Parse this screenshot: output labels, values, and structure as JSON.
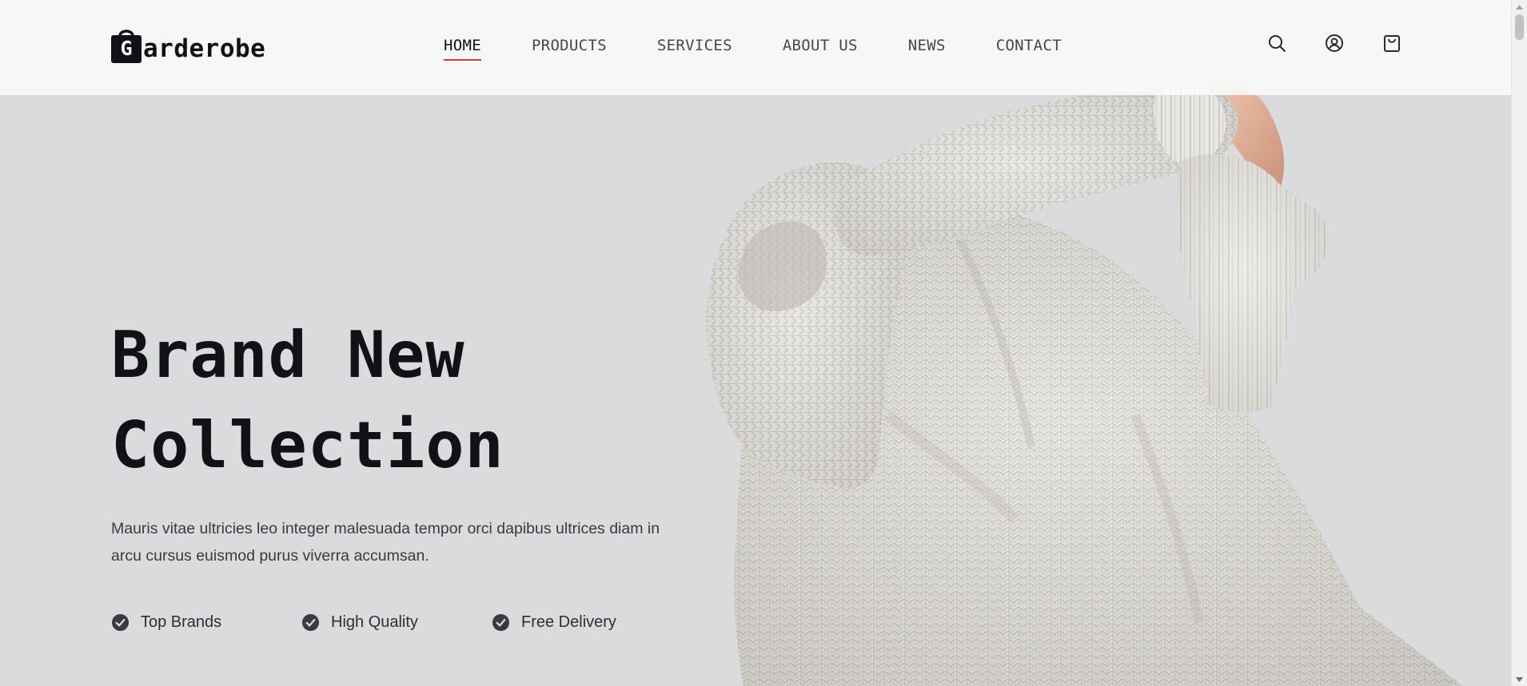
{
  "brand": {
    "logo_letter": "G",
    "logo_text": "arderobe"
  },
  "nav": {
    "items": [
      {
        "label": "HOME",
        "active": true
      },
      {
        "label": "PRODUCTS",
        "active": false
      },
      {
        "label": "SERVICES",
        "active": false
      },
      {
        "label": "ABOUT US",
        "active": false
      },
      {
        "label": "NEWS",
        "active": false
      },
      {
        "label": "CONTACT",
        "active": false
      }
    ]
  },
  "header_icons": [
    "search-icon",
    "account-icon",
    "shopping-bag-icon"
  ],
  "hero": {
    "title_line1": "Brand New",
    "title_line2": "Collection",
    "description": "Mauris vitae ultricies leo integer malesuada tempor orci dapibus ultrices diam in arcu cursus euismod purus viverra accumsan.",
    "features": [
      {
        "label": "Top Brands",
        "icon": "check-circle-icon"
      },
      {
        "label": "High Quality",
        "icon": "check-circle-icon"
      },
      {
        "label": "Free Delivery",
        "icon": "check-circle-icon"
      }
    ],
    "image": "knit-sweater-photo"
  },
  "colors": {
    "accent": "#d93636",
    "text_dark": "#121116",
    "hero_background": "#dadbdd",
    "header_background": "#f8f9f9"
  }
}
